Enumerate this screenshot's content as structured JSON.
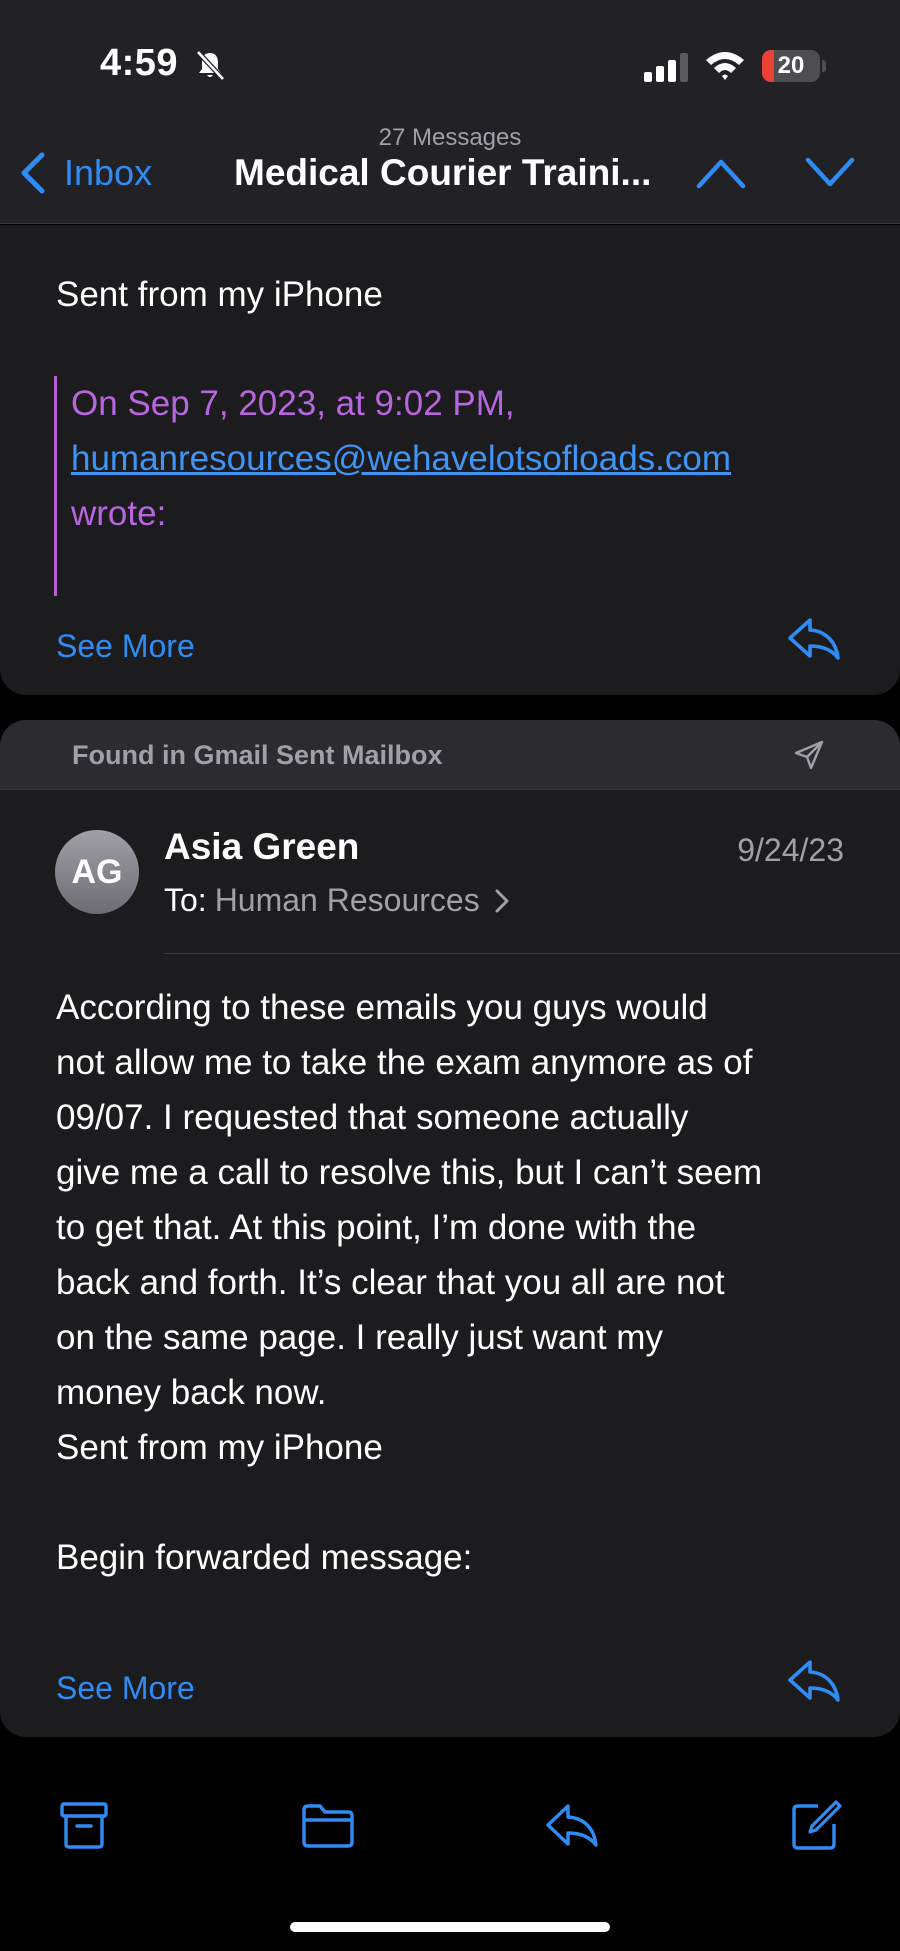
{
  "status_bar": {
    "time": "4:59",
    "battery": "20",
    "battery_level": 0.2,
    "battery_color": "#eb4034"
  },
  "nav": {
    "back_label": "Inbox",
    "message_count": "27 Messages",
    "thread_title": "Medical Courier Traini...",
    "accent_color": "#2f8cf5"
  },
  "message_1": {
    "closing": "Sent from my iPhone",
    "quote_header": "On Sep 7, 2023, at 9:02 PM,",
    "quote_email": "humanresources@wehavelotsofloads.com",
    "quote_wrote": "wrote:",
    "see_more": "See More"
  },
  "message_2": {
    "found_in": "Found in Gmail Sent Mailbox",
    "avatar_initials": "AG",
    "sender": "Asia Green",
    "date": "9/24/23",
    "to_label": "To:",
    "to_name": "Human Resources",
    "body_lines": [
      "According to these emails you guys would",
      "not allow me to take the exam anymore as of",
      "09/07. I requested that someone actually",
      "give me a call to resolve this, but I can’t seem",
      "to get that. At this point, I’m done with the",
      "back and forth. It’s clear that you all are not",
      "on the same page. I really just want my",
      "money back now."
    ],
    "closing": "Sent from my iPhone",
    "forwarded": "Begin forwarded message:",
    "see_more": "See More"
  },
  "toolbar": {
    "icons": [
      "archive-icon",
      "folder-icon",
      "reply-icon",
      "compose-icon"
    ]
  }
}
